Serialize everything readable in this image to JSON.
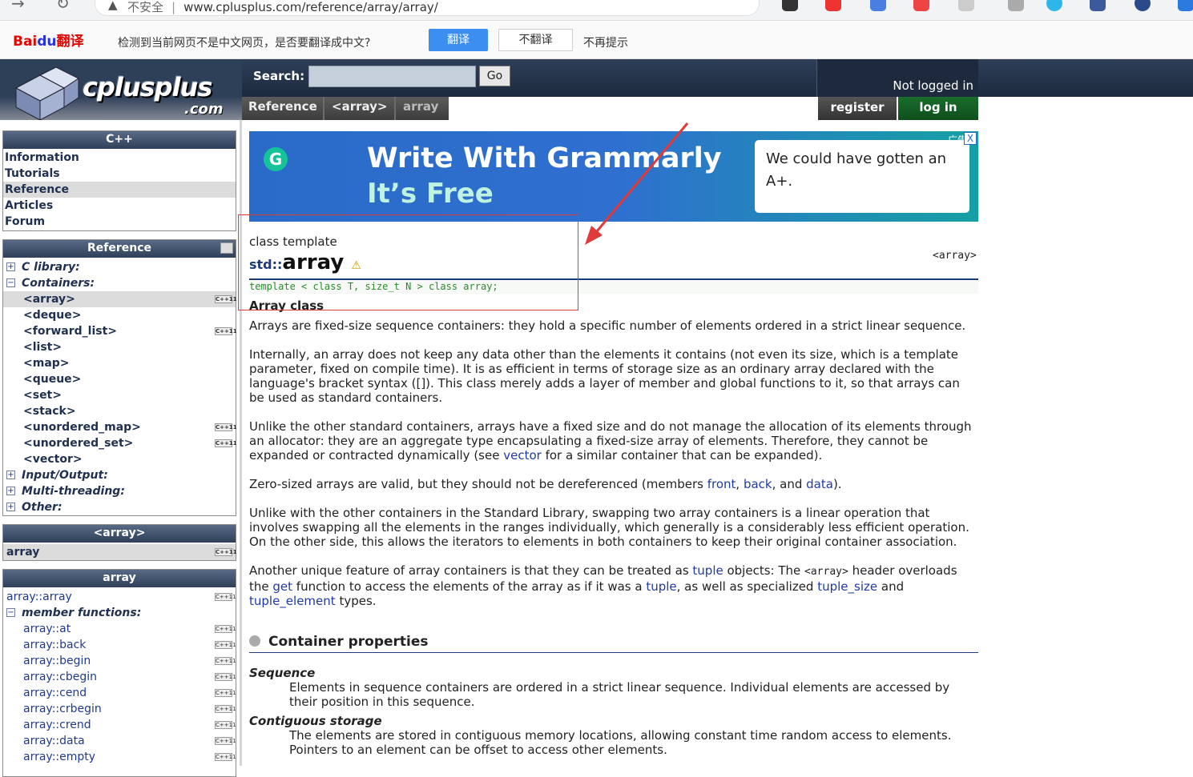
{
  "browser": {
    "security": "不安全",
    "url": "www.cplusplus.com/reference/array/array/"
  },
  "translate_bar": {
    "brand": "Bai",
    "brand_du": "du",
    "brand_suffix": "翻译",
    "message": "检测到当前网页不是中文网页，是否要翻译成中文?",
    "translate_btn": "翻译",
    "no_translate_btn": "不翻译",
    "never_btn": "不再提示"
  },
  "header": {
    "logo_name": "cplusplus",
    "logo_com": ".com",
    "search_label": "Search:",
    "search_value": "",
    "go_label": "Go",
    "not_logged": "Not logged in",
    "register": "register",
    "login": "log in",
    "breadcrumbs": [
      "Reference",
      "<array>",
      "array"
    ]
  },
  "sidebar": {
    "cpp_title": "C++",
    "cpp_items": [
      "Information",
      "Tutorials",
      "Reference",
      "Articles",
      "Forum"
    ],
    "ref_title": "Reference",
    "ref_groups": [
      "C library:",
      "Containers:",
      "Input/Output:",
      "Multi-threading:",
      "Other:"
    ],
    "containers": [
      "<array>",
      "<deque>",
      "<forward_list>",
      "<list>",
      "<map>",
      "<queue>",
      "<set>",
      "<stack>",
      "<unordered_map>",
      "<unordered_set>",
      "<vector>"
    ],
    "array_header_title": "<array>",
    "array_header_item": "array",
    "array_title": "array",
    "array_ctor": "array::array",
    "member_functions_label": "member functions:",
    "members": [
      "array::at",
      "array::back",
      "array::begin",
      "array::cbegin",
      "array::cend",
      "array::crbegin",
      "array::crend",
      "array::data",
      "array::empty"
    ],
    "cxx_badge": "C++11"
  },
  "ad": {
    "headline": "Write With Grammarly",
    "subline": "It’s Free",
    "card_text": "We could have gotten an A+.",
    "ad_tag": "广告",
    "close": "X",
    "logo_letter": "G"
  },
  "article": {
    "type_label": "class template",
    "namespace": "std::",
    "name": "array",
    "header_tag": "<array>",
    "declaration": "template < class T, size_t N > class array;",
    "class_title": "Array class",
    "p1": "Arrays are fixed-size sequence containers: they hold a specific number of elements ordered in a strict linear sequence.",
    "p2": "Internally, an array does not keep any data other than the elements it contains (not even its size, which is a template parameter, fixed on compile time). It is as efficient in terms of storage size as an ordinary array declared with the language's bracket syntax ([]). This class merely adds a layer of member and global functions to it, so that arrays can be used as standard containers.",
    "p3a": "Unlike the other standard containers, arrays have a fixed size and do not manage the allocation of its elements through an allocator: they are an aggregate type encapsulating a fixed-size array of elements. Therefore, they cannot be expanded or contracted dynamically (see ",
    "p3_link": "vector",
    "p3b": " for a similar container that can be expanded).",
    "p4a": "Zero-sized arrays are valid, but they should not be dereferenced (members ",
    "p4_front": "front",
    "p4_sep1": ", ",
    "p4_back": "back",
    "p4_sep2": ", and ",
    "p4_data": "data",
    "p4b": ").",
    "p5": "Unlike with the other containers in the Standard Library, swapping two array containers is a linear operation that involves swapping all the elements in the ranges individually, which generally is a considerably less efficient operation. On the other side, this allows the iterators to elements in both containers to keep their original container association.",
    "p6a": "Another unique feature of array containers is that they can be treated as ",
    "p6_tuple": "tuple",
    "p6b": " objects: The ",
    "p6_header": "<array>",
    "p6c": " header overloads the ",
    "p6_get": "get",
    "p6d": " function to access the elements of the array as if it was a ",
    "p6_tuple2": "tuple",
    "p6e": ", as well as specialized ",
    "p6_tuple_size": "tuple_size",
    "p6f": " and ",
    "p6_tuple_element": "tuple_element",
    "p6g": " types.",
    "section_title": "Container properties",
    "prop1_title": "Sequence",
    "prop1_text": "Elements in sequence containers are ordered in a strict linear sequence. Individual elements are accessed by their position in this sequence.",
    "prop2_title": "Contiguous storage",
    "prop2_text": "The elements are stored in contiguous memory locations, allowing constant time random access to elements. Pointers to an element can be offset to access other elements."
  },
  "colors": {
    "header_dark": "#1d2a3e",
    "link": "#1f3aa8",
    "annotation_red": "#e03a3a",
    "login_green": "#0f4e1c"
  }
}
